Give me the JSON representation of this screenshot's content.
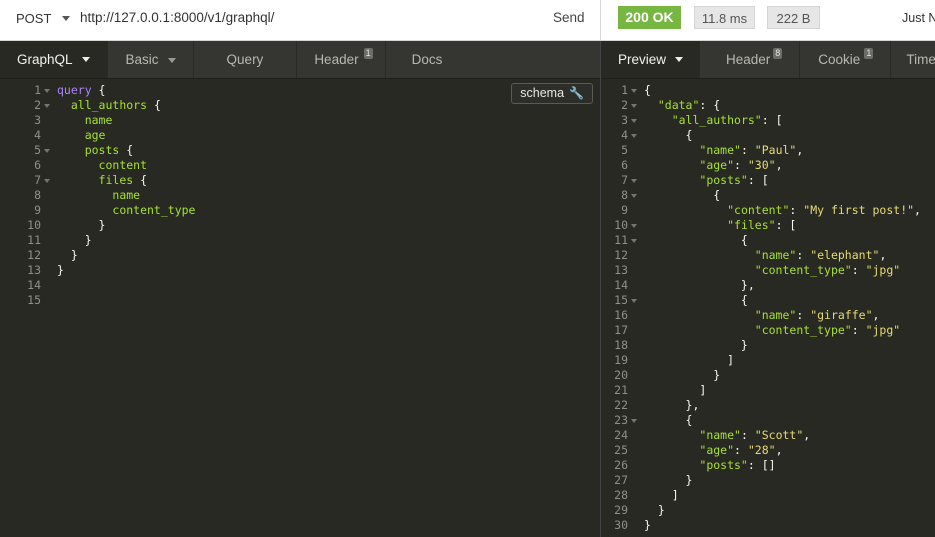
{
  "request": {
    "method": "POST",
    "url": "http://127.0.0.1:8000/v1/graphql/",
    "send_label": "Send"
  },
  "response_meta": {
    "status": "200 OK",
    "time": "11.8 ms",
    "size": "222 B",
    "received": "Just N",
    "status_color": "#77b741"
  },
  "left_tabs": [
    {
      "label": "GraphQL",
      "active": true,
      "dropdown": true
    },
    {
      "label": "Basic",
      "dropdown": true
    },
    {
      "label": "Query"
    },
    {
      "label": "Header",
      "badge": "1"
    },
    {
      "label": "Docs"
    }
  ],
  "right_tabs": [
    {
      "label": "Preview",
      "active": true,
      "dropdown": true
    },
    {
      "label": "Header",
      "badge": "8"
    },
    {
      "label": "Cookie",
      "badge": "1"
    },
    {
      "label": "Timeline"
    }
  ],
  "schema_button": {
    "label": "schema",
    "icon": "wrench-icon"
  },
  "query_lines": [
    {
      "n": "1",
      "fold": true,
      "tokens": [
        [
          "kw",
          "query"
        ],
        [
          "pu",
          " {"
        ]
      ]
    },
    {
      "n": "2",
      "fold": true,
      "tokens": [
        [
          "pu",
          "  "
        ],
        [
          "fld",
          "all_authors"
        ],
        [
          "pu",
          " {"
        ]
      ]
    },
    {
      "n": "3",
      "tokens": [
        [
          "pu",
          "    "
        ],
        [
          "fld",
          "name"
        ]
      ]
    },
    {
      "n": "4",
      "tokens": [
        [
          "pu",
          "    "
        ],
        [
          "fld",
          "age"
        ]
      ]
    },
    {
      "n": "5",
      "fold": true,
      "tokens": [
        [
          "pu",
          "    "
        ],
        [
          "fld",
          "posts"
        ],
        [
          "pu",
          " {"
        ]
      ]
    },
    {
      "n": "6",
      "tokens": [
        [
          "pu",
          "      "
        ],
        [
          "fld",
          "content"
        ]
      ]
    },
    {
      "n": "7",
      "fold": true,
      "tokens": [
        [
          "pu",
          "      "
        ],
        [
          "fld",
          "files"
        ],
        [
          "pu",
          " {"
        ]
      ]
    },
    {
      "n": "8",
      "tokens": [
        [
          "pu",
          "        "
        ],
        [
          "fld",
          "name"
        ]
      ]
    },
    {
      "n": "9",
      "tokens": [
        [
          "pu",
          "        "
        ],
        [
          "fld",
          "content_type"
        ]
      ]
    },
    {
      "n": "10",
      "tokens": [
        [
          "pu",
          "      }"
        ]
      ]
    },
    {
      "n": "11",
      "tokens": [
        [
          "pu",
          "    }"
        ]
      ]
    },
    {
      "n": "12",
      "tokens": [
        [
          "pu",
          "  }"
        ]
      ]
    },
    {
      "n": "13",
      "tokens": [
        [
          "pu",
          "}"
        ]
      ]
    },
    {
      "n": "14",
      "tokens": []
    },
    {
      "n": "15",
      "tokens": []
    }
  ],
  "response_lines": [
    {
      "n": "1",
      "fold": true,
      "tokens": [
        [
          "pu",
          "{"
        ]
      ]
    },
    {
      "n": "2",
      "fold": true,
      "tokens": [
        [
          "pu",
          "  "
        ],
        [
          "key",
          "\"data\""
        ],
        [
          "pu",
          ": {"
        ]
      ]
    },
    {
      "n": "3",
      "fold": true,
      "tokens": [
        [
          "pu",
          "    "
        ],
        [
          "key",
          "\"all_authors\""
        ],
        [
          "pu",
          ": ["
        ]
      ]
    },
    {
      "n": "4",
      "fold": true,
      "tokens": [
        [
          "pu",
          "      {"
        ]
      ]
    },
    {
      "n": "5",
      "tokens": [
        [
          "pu",
          "        "
        ],
        [
          "key",
          "\"name\""
        ],
        [
          "pu",
          ": "
        ],
        [
          "str",
          "\"Paul\""
        ],
        [
          "pu",
          ","
        ]
      ]
    },
    {
      "n": "6",
      "tokens": [
        [
          "pu",
          "        "
        ],
        [
          "key",
          "\"age\""
        ],
        [
          "pu",
          ": "
        ],
        [
          "str",
          "\"30\""
        ],
        [
          "pu",
          ","
        ]
      ]
    },
    {
      "n": "7",
      "fold": true,
      "tokens": [
        [
          "pu",
          "        "
        ],
        [
          "key",
          "\"posts\""
        ],
        [
          "pu",
          ": ["
        ]
      ]
    },
    {
      "n": "8",
      "fold": true,
      "tokens": [
        [
          "pu",
          "          {"
        ]
      ]
    },
    {
      "n": "9",
      "tokens": [
        [
          "pu",
          "            "
        ],
        [
          "key",
          "\"content\""
        ],
        [
          "pu",
          ": "
        ],
        [
          "str",
          "\"My first post!\""
        ],
        [
          "pu",
          ","
        ]
      ]
    },
    {
      "n": "10",
      "fold": true,
      "tokens": [
        [
          "pu",
          "            "
        ],
        [
          "key",
          "\"files\""
        ],
        [
          "pu",
          ": ["
        ]
      ]
    },
    {
      "n": "11",
      "fold": true,
      "tokens": [
        [
          "pu",
          "              {"
        ]
      ]
    },
    {
      "n": "12",
      "tokens": [
        [
          "pu",
          "                "
        ],
        [
          "key",
          "\"name\""
        ],
        [
          "pu",
          ": "
        ],
        [
          "str",
          "\"elephant\""
        ],
        [
          "pu",
          ","
        ]
      ]
    },
    {
      "n": "13",
      "tokens": [
        [
          "pu",
          "                "
        ],
        [
          "key",
          "\"content_type\""
        ],
        [
          "pu",
          ": "
        ],
        [
          "str",
          "\"jpg\""
        ]
      ]
    },
    {
      "n": "14",
      "tokens": [
        [
          "pu",
          "              },"
        ]
      ]
    },
    {
      "n": "15",
      "fold": true,
      "tokens": [
        [
          "pu",
          "              {"
        ]
      ]
    },
    {
      "n": "16",
      "tokens": [
        [
          "pu",
          "                "
        ],
        [
          "key",
          "\"name\""
        ],
        [
          "pu",
          ": "
        ],
        [
          "str",
          "\"giraffe\""
        ],
        [
          "pu",
          ","
        ]
      ]
    },
    {
      "n": "17",
      "tokens": [
        [
          "pu",
          "                "
        ],
        [
          "key",
          "\"content_type\""
        ],
        [
          "pu",
          ": "
        ],
        [
          "str",
          "\"jpg\""
        ]
      ]
    },
    {
      "n": "18",
      "tokens": [
        [
          "pu",
          "              }"
        ]
      ]
    },
    {
      "n": "19",
      "tokens": [
        [
          "pu",
          "            ]"
        ]
      ]
    },
    {
      "n": "20",
      "tokens": [
        [
          "pu",
          "          }"
        ]
      ]
    },
    {
      "n": "21",
      "tokens": [
        [
          "pu",
          "        ]"
        ]
      ]
    },
    {
      "n": "22",
      "tokens": [
        [
          "pu",
          "      },"
        ]
      ]
    },
    {
      "n": "23",
      "fold": true,
      "tokens": [
        [
          "pu",
          "      {"
        ]
      ]
    },
    {
      "n": "24",
      "tokens": [
        [
          "pu",
          "        "
        ],
        [
          "key",
          "\"name\""
        ],
        [
          "pu",
          ": "
        ],
        [
          "str",
          "\"Scott\""
        ],
        [
          "pu",
          ","
        ]
      ]
    },
    {
      "n": "25",
      "tokens": [
        [
          "pu",
          "        "
        ],
        [
          "key",
          "\"age\""
        ],
        [
          "pu",
          ": "
        ],
        [
          "str",
          "\"28\""
        ],
        [
          "pu",
          ","
        ]
      ]
    },
    {
      "n": "26",
      "tokens": [
        [
          "pu",
          "        "
        ],
        [
          "key",
          "\"posts\""
        ],
        [
          "pu",
          ": []"
        ]
      ]
    },
    {
      "n": "27",
      "tokens": [
        [
          "pu",
          "      }"
        ]
      ]
    },
    {
      "n": "28",
      "tokens": [
        [
          "pu",
          "    ]"
        ]
      ]
    },
    {
      "n": "29",
      "tokens": [
        [
          "pu",
          "  }"
        ]
      ]
    },
    {
      "n": "30",
      "tokens": [
        [
          "pu",
          "}"
        ]
      ]
    }
  ]
}
